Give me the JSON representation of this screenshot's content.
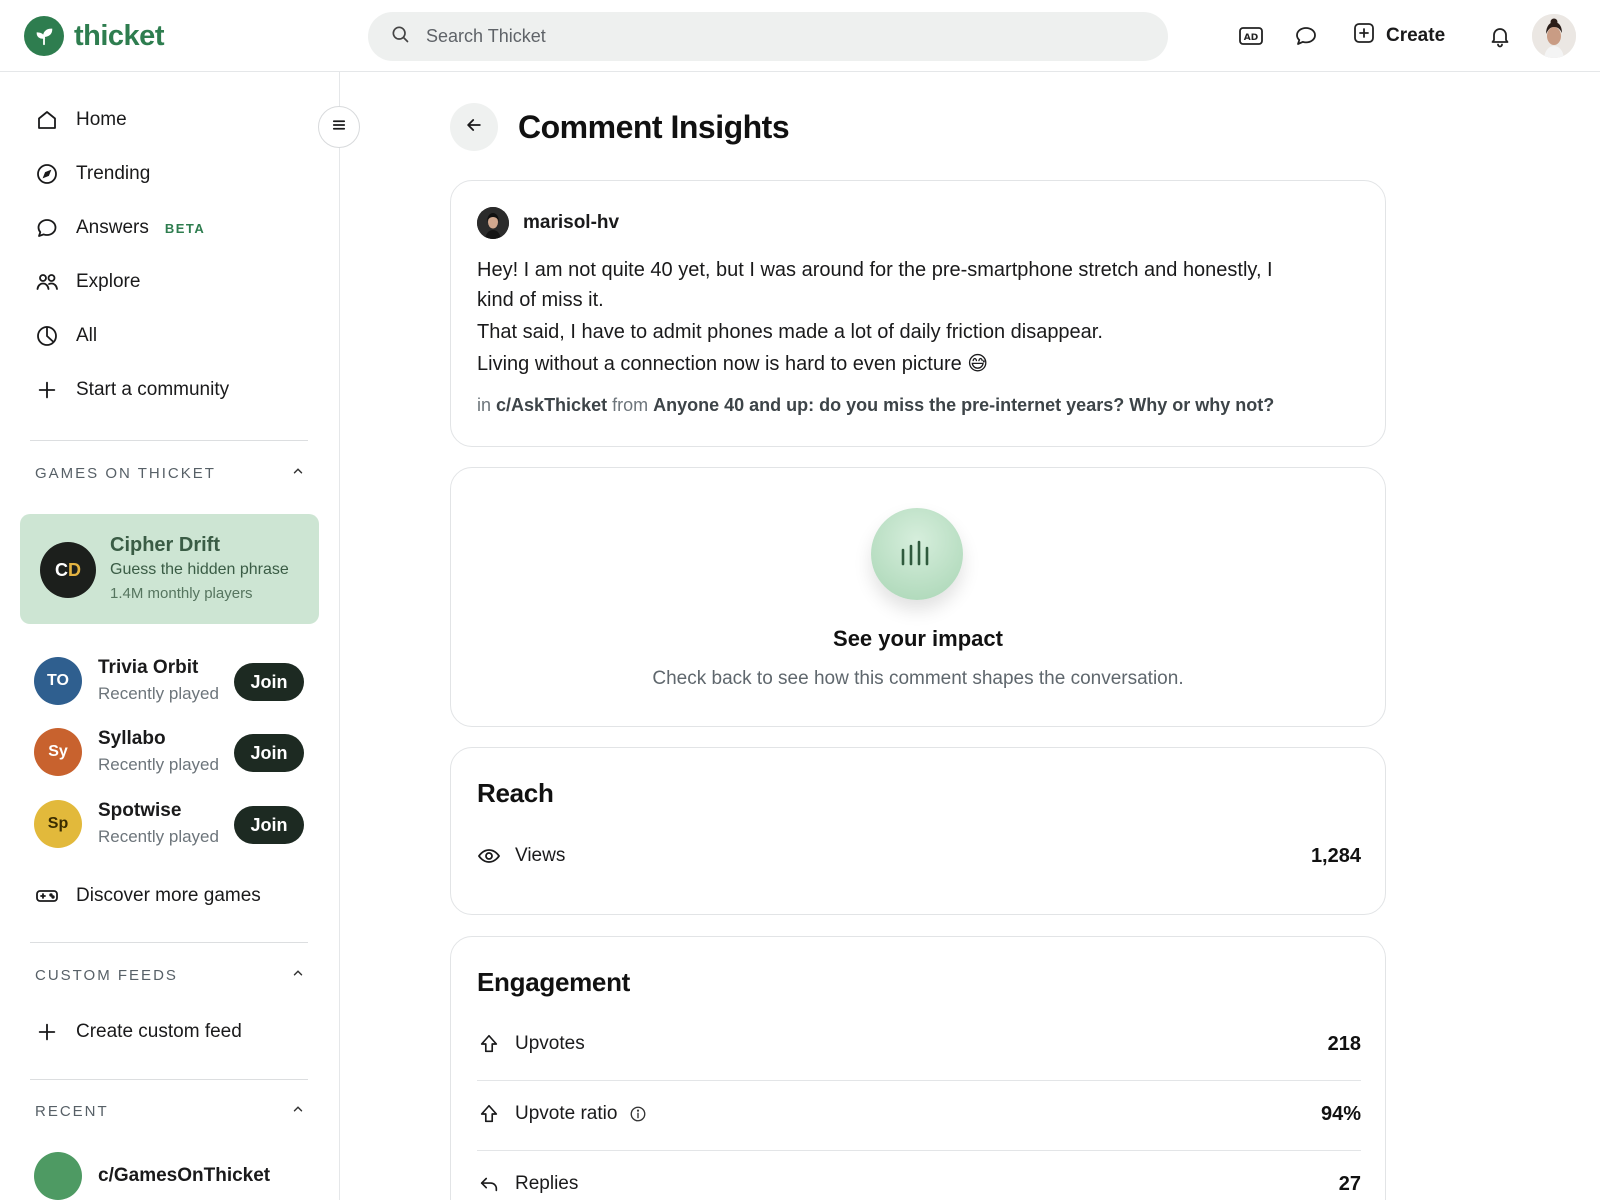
{
  "header": {
    "brand": "thicket",
    "search_placeholder": "Search Thicket",
    "create_label": "Create"
  },
  "sidebar": {
    "nav": [
      {
        "label": "Home",
        "icon": "home-icon"
      },
      {
        "label": "Trending",
        "icon": "compass-icon"
      },
      {
        "label": "Answers",
        "icon": "chat-bubble-icon",
        "badge": "BETA"
      },
      {
        "label": "Explore",
        "icon": "people-icon"
      },
      {
        "label": "All",
        "icon": "clock-icon"
      },
      {
        "label": "Start a community",
        "icon": "plus-icon"
      }
    ],
    "games_section": "GAMES ON THICKET",
    "featured_game": {
      "initials_main": "C",
      "initials_accent": "D",
      "title": "Cipher Drift",
      "subtitle": "Guess the hidden phrase",
      "meta": "1.4M monthly players"
    },
    "games": [
      {
        "initials": "TO",
        "name": "Trivia Orbit",
        "status": "Recently played",
        "join": "Join",
        "color": "#2f5f8f"
      },
      {
        "initials": "Sy",
        "name": "Syllabo",
        "status": "Recently played",
        "join": "Join",
        "color": "#c8622e"
      },
      {
        "initials": "Sp",
        "name": "Spotwise",
        "status": "Recently played",
        "join": "Join",
        "color": "#e2b93b"
      }
    ],
    "discover_label": "Discover more games",
    "custom_feeds_section": "CUSTOM FEEDS",
    "create_feed_label": "Create custom feed",
    "recent_section": "RECENT",
    "recent_item": "c/GamesOnThicket"
  },
  "main": {
    "title": "Comment Insights",
    "comment": {
      "author": "marisol-hv",
      "lines": [
        "Hey! I am not quite 40 yet, but I was around for the pre-smartphone stretch and honestly, I kind of miss it.",
        "That said, I have to admit phones made a lot of daily friction disappear.",
        "Living without a connection now is hard to even picture 😅"
      ],
      "in_label": "in",
      "community": "c/AskThicket",
      "from_label": "from",
      "post_title": "Anyone 40 and up: do you miss the pre-internet years? Why or why not?"
    },
    "impact": {
      "title": "See your impact",
      "subtitle": "Check back to see how this comment shapes the conversation."
    },
    "reach": {
      "title": "Reach",
      "views_label": "Views",
      "views_value": "1,284"
    },
    "engagement": {
      "title": "Engagement",
      "upvotes_label": "Upvotes",
      "upvotes_value": "218",
      "ratio_label": "Upvote ratio",
      "ratio_value": "94%",
      "replies_label": "Replies",
      "replies_value": "27"
    }
  },
  "colors": {
    "brand": "#2e7d4f",
    "featured_card_bg": "#cde5d3",
    "join_button": "#1d2a22"
  }
}
